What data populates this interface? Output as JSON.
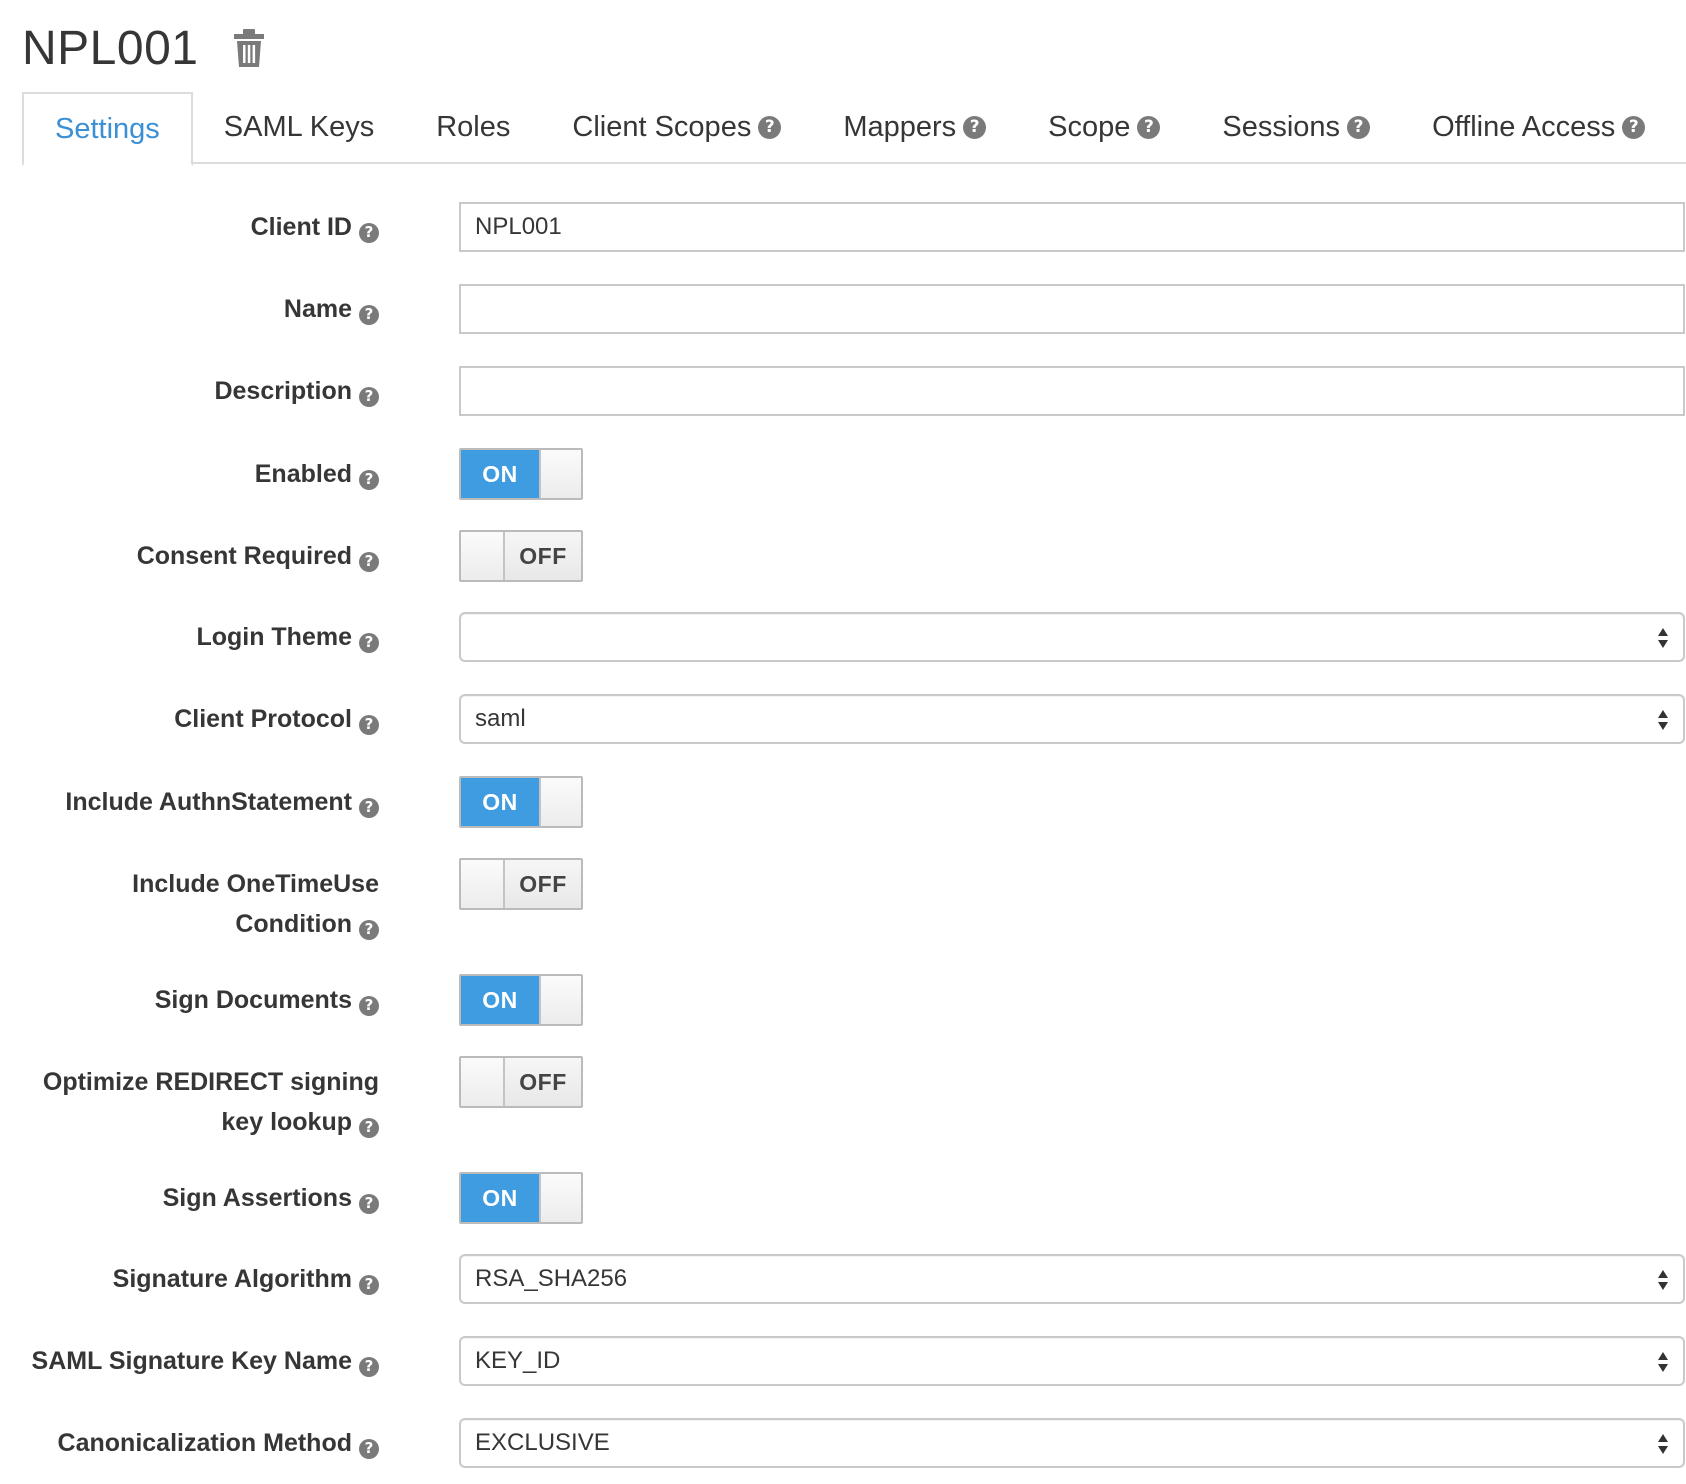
{
  "header": {
    "title": "NPL001",
    "delete_icon": "trash-icon"
  },
  "tabs": [
    {
      "label": "Settings",
      "active": true,
      "help": false
    },
    {
      "label": "SAML Keys",
      "active": false,
      "help": false
    },
    {
      "label": "Roles",
      "active": false,
      "help": false
    },
    {
      "label": "Client Scopes",
      "active": false,
      "help": true
    },
    {
      "label": "Mappers",
      "active": false,
      "help": true
    },
    {
      "label": "Scope",
      "active": false,
      "help": true
    },
    {
      "label": "Sessions",
      "active": false,
      "help": true
    },
    {
      "label": "Offline Access",
      "active": false,
      "help": true
    }
  ],
  "help_glyph": "?",
  "toggle_text": {
    "on": "ON",
    "off": "OFF"
  },
  "form": {
    "client_id": {
      "label": "Client ID",
      "value": "NPL001"
    },
    "name": {
      "label": "Name",
      "value": ""
    },
    "description": {
      "label": "Description",
      "value": ""
    },
    "enabled": {
      "label": "Enabled",
      "state": "ON"
    },
    "consent_required": {
      "label": "Consent Required",
      "state": "OFF"
    },
    "login_theme": {
      "label": "Login Theme",
      "value": ""
    },
    "client_protocol": {
      "label": "Client Protocol",
      "value": "saml"
    },
    "include_authn_statement": {
      "label": "Include AuthnStatement",
      "state": "ON"
    },
    "include_onetimeuse_condition": {
      "label_line1": "Include OneTimeUse",
      "label_line2": "Condition",
      "state": "OFF"
    },
    "sign_documents": {
      "label": "Sign Documents",
      "state": "ON"
    },
    "optimize_redirect_signing": {
      "label_line1": "Optimize REDIRECT signing",
      "label_line2": "key lookup",
      "state": "OFF"
    },
    "sign_assertions": {
      "label": "Sign Assertions",
      "state": "ON"
    },
    "signature_algorithm": {
      "label": "Signature Algorithm",
      "value": "RSA_SHA256"
    },
    "saml_signature_key_name": {
      "label": "SAML Signature Key Name",
      "value": "KEY_ID"
    },
    "canonicalization_method": {
      "label": "Canonicalization Method",
      "value": "EXCLUSIVE"
    }
  },
  "colors": {
    "accent": "#3f9ce0",
    "tab_active": "#3b8fd3",
    "text": "#363636",
    "border": "#c9c9c9"
  }
}
